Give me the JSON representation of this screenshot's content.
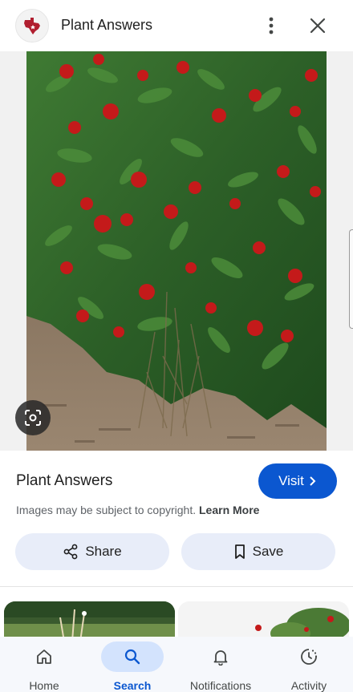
{
  "header": {
    "site_name": "Plant Answers",
    "favicon": "texas-state-icon",
    "more_icon": "more-vert-icon",
    "close_icon": "close-icon"
  },
  "image": {
    "lens_icon": "lens-camera-icon"
  },
  "info": {
    "title": "Plant Answers",
    "visit_label": "Visit",
    "copyright_text": "Images may be subject to copyright.",
    "learn_more_label": "Learn More"
  },
  "actions": {
    "share_label": "Share",
    "save_label": "Save"
  },
  "nav": {
    "items": [
      {
        "label": "Home",
        "icon": "home-icon"
      },
      {
        "label": "Search",
        "icon": "search-icon"
      },
      {
        "label": "Notifications",
        "icon": "bell-icon"
      },
      {
        "label": "Activity",
        "icon": "activity-icon"
      }
    ],
    "active": "Search"
  },
  "colors": {
    "accent": "#0b57d0",
    "button_bg": "#e8edf9",
    "nav_active_bg": "#d3e3fd",
    "foliage": "#2f6b2a",
    "flower_red": "#c41a1a",
    "mulch": "#8a7460"
  }
}
